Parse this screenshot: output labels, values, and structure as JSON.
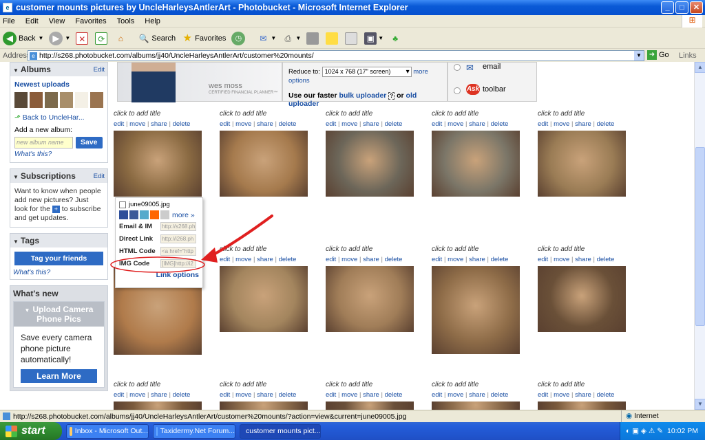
{
  "window": {
    "title": "customer mounts pictures by UncleHarleysAntlerArt - Photobucket - Microsoft Internet Explorer",
    "min": "_",
    "max": "□",
    "close": "✕"
  },
  "menu": [
    "File",
    "Edit",
    "View",
    "Favorites",
    "Tools",
    "Help"
  ],
  "toolbar": {
    "back": "Back",
    "search": "Search",
    "favorites": "Favorites"
  },
  "address": {
    "label": "Address",
    "url": "http://s268.photobucket.com/albums/jj40/UncleHarleysAntlerArt/customer%20mounts/",
    "go": "Go",
    "links": "Links"
  },
  "sidebar": {
    "albums": {
      "title": "Albums",
      "edit": "Edit",
      "newest": "Newest uploads",
      "back": "Back to UncleHar...",
      "add_label": "Add a new album:",
      "placeholder": "new album name",
      "save": "Save",
      "whats_this": "What's this?"
    },
    "subscriptions": {
      "title": "Subscriptions",
      "edit": "Edit",
      "text_a": "Want to know when people add new pictures? Just look for the",
      "text_b": "to subscribe and get updates."
    },
    "tags": {
      "title": "Tags",
      "button": "Tag your friends",
      "whats_this": "What's this?"
    },
    "whatsnew": {
      "title": "What's new",
      "box_title": "Upload Camera Phone Pics",
      "box_text": "Save every camera phone picture automatically!",
      "button": "Learn More"
    }
  },
  "banner": {
    "name": "wes moss",
    "cert": "CERTIFIED FINANCIAL PLANNER™"
  },
  "reduce": {
    "label": "Reduce to:",
    "value": "1024 x 768 (17\" screen)",
    "more": "more options",
    "faster": "Use our faster",
    "bulk": "bulk uploader",
    "or": "or",
    "old": "old uploader"
  },
  "share": {
    "email": "email",
    "toolbar": "toolbar"
  },
  "cell_labels": {
    "title": "click to add title",
    "edit": "edit",
    "move": "move",
    "share": "share",
    "delete": "delete"
  },
  "popup": {
    "filename": "june09005.jpg",
    "more": "more »",
    "rows": [
      {
        "label": "Email & IM",
        "value": "http://s268.ph"
      },
      {
        "label": "Direct Link",
        "value": "http://i268.ph"
      },
      {
        "label": "HTML Code",
        "value": "<a href=\"http"
      },
      {
        "label": "IMG Code",
        "value": "[IMG]http://i2"
      }
    ],
    "link_options": "Link options"
  },
  "status": {
    "text": "http://s268.photobucket.com/albums/jj40/UncleHarleysAntlerArt/customer%20mounts/?action=view&current=june09005.jpg",
    "zone": "Internet"
  },
  "taskbar": {
    "start": "start",
    "tasks": [
      "Inbox - Microsoft Out...",
      "Taxidermy.Net Forum...",
      "customer mounts pict..."
    ],
    "time": "10:02 PM"
  },
  "colors": {
    "titlebar": "#0a5ad6",
    "link": "#1a4fa3",
    "button": "#2e6bc4",
    "annotation": "#e02020"
  }
}
